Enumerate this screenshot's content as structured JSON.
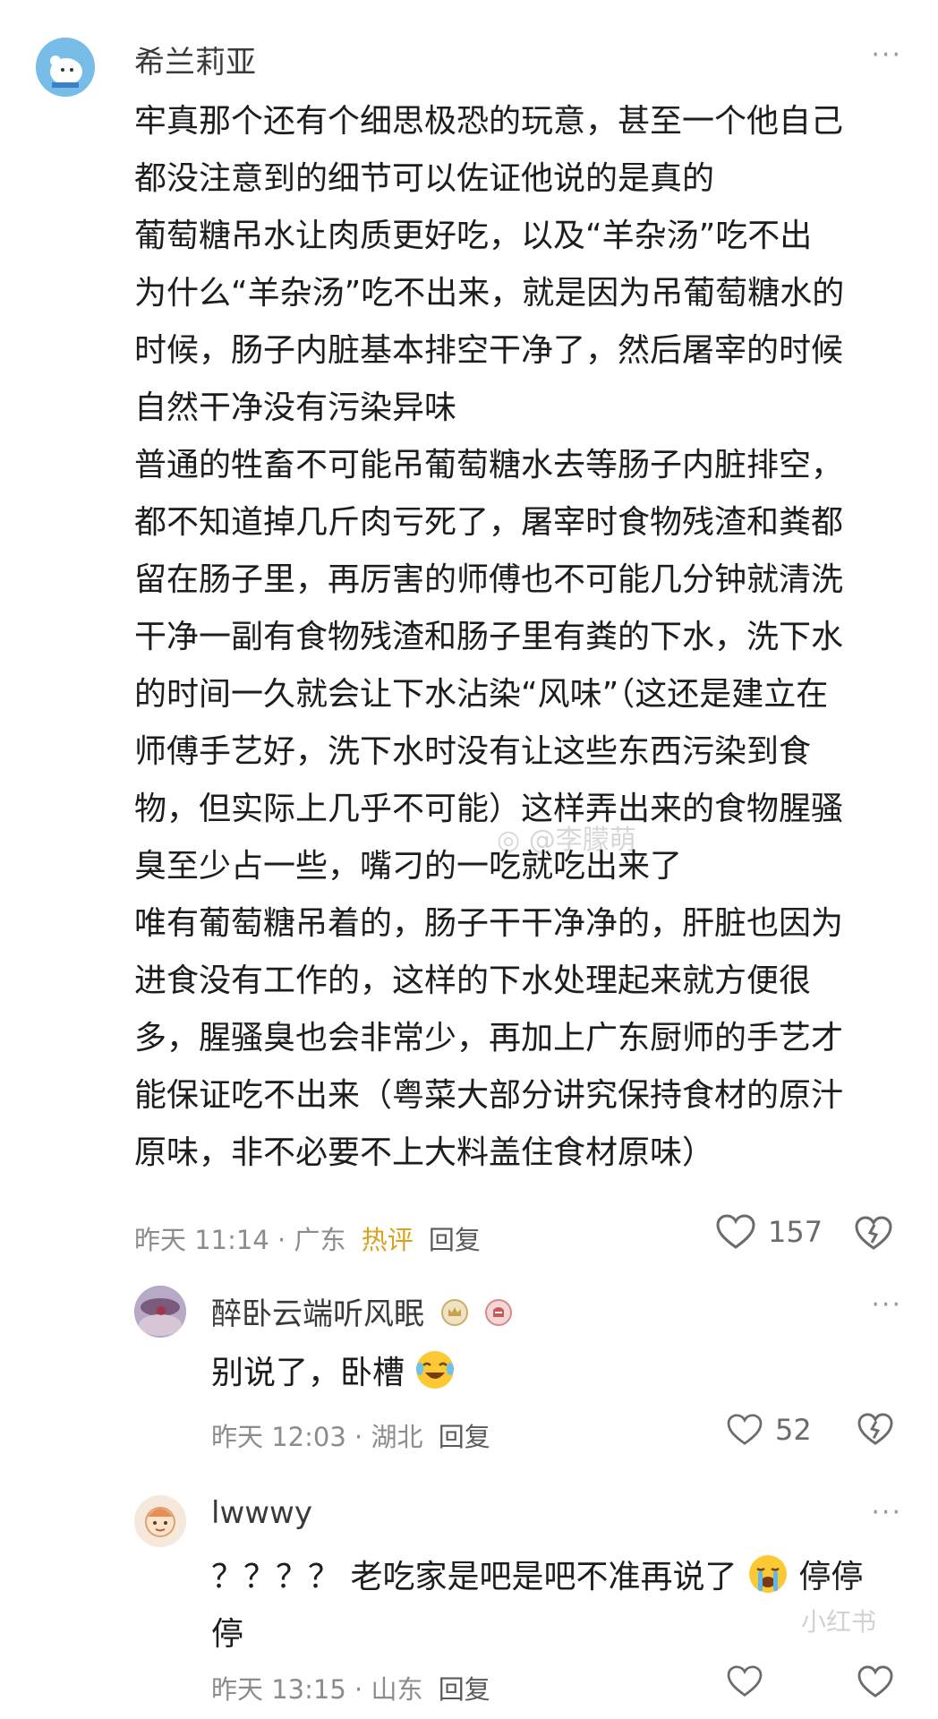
{
  "comments": [
    {
      "author": "希兰莉亚",
      "more": "···",
      "lines": [
        "牢真那个还有个细思极恐的玩意，甚至一个他自己",
        "都没注意到的细节可以佐证他说的是真的",
        "葡萄糖吊水让肉质更好吃，以及“羊杂汤”吃不出",
        "为什么“羊杂汤”吃不出来，就是因为吊葡萄糖水的",
        "时候，肠子内脏基本排空干净了，然后屠宰的时候",
        "自然干净没有污染异味",
        "普通的牲畜不可能吊葡萄糖水去等肠子内脏排空，",
        "都不知道掉几斤肉亏死了，屠宰时食物残渣和粪都",
        "留在肠子里，再厉害的师傅也不可能几分钟就清洗",
        "干净一副有食物残渣和肠子里有粪的下水，洗下水",
        "的时间一久就会让下水沾染“风味”（这还是建立在",
        "师傅手艺好，洗下水时没有让这些东西污染到食",
        "物，但实际上几乎不可能）这样弄出来的食物腥骚",
        "臭至少占一些，嘴刁的一吃就吃出来了",
        "唯有葡萄糖吊着的，肠子干干净净的，肝脏也因为",
        "进食没有工作的，这样的下水处理起来就方便很",
        "多，腥骚臭也会非常少，再加上广东厨师的手艺才",
        "能保证吃不出来（粤菜大部分讲究保持食材的原汁",
        "原味，非不必要不上大料盖住食材原味）"
      ],
      "time": "昨天 11:14",
      "location": "广东",
      "hot_label": "热评",
      "reply_label": "回复",
      "likes": "157"
    },
    {
      "author": "醉卧云端听风眠",
      "more": "···",
      "text": "别说了，卧槽",
      "emoji": "laughing-crying-emoji",
      "time": "昨天 12:03",
      "location": "湖北",
      "reply_label": "回复",
      "likes": "52"
    },
    {
      "author": "lwwwy",
      "more": "···",
      "line1": "？？？？ 老吃家是吧是吧不准再说了",
      "line1_tail": "停停",
      "line2": "停",
      "emoji": "crying-emoji",
      "time": "昨天 13:15",
      "location": "山东",
      "reply_label": "回复"
    }
  ],
  "watermarks": {
    "weibo": "@李朦萌",
    "corner": "小红书"
  },
  "colors": {
    "hot": "#d8a21c",
    "meta": "#8c8c8c",
    "text": "#1d1d1d"
  }
}
